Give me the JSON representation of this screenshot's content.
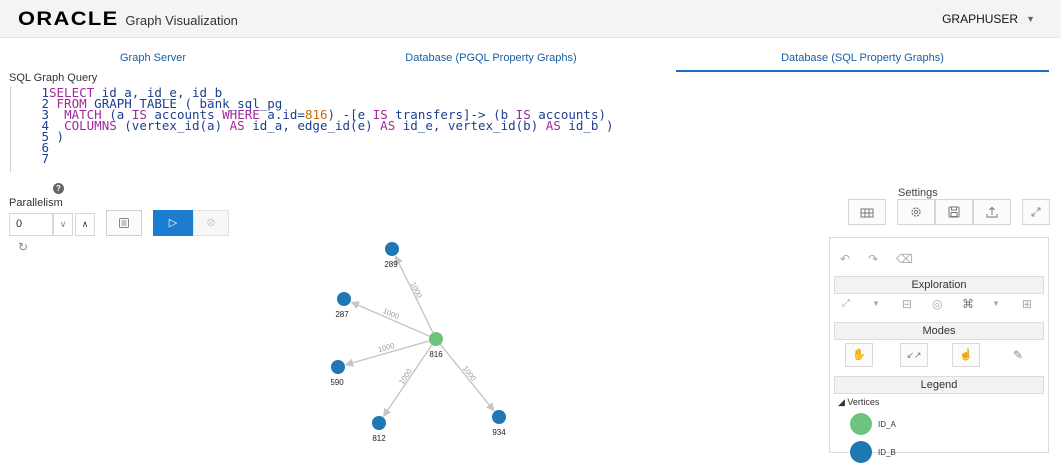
{
  "header": {
    "logo": "ORACLE",
    "title": "Graph Visualization",
    "user": "GRAPHUSER",
    "user_caret": "▼"
  },
  "tabs": [
    {
      "label": "Graph Server",
      "active": false
    },
    {
      "label": "Database (PGQL Property Graphs)",
      "active": false
    },
    {
      "label": "Database (SQL Property Graphs)",
      "active": true
    }
  ],
  "query": {
    "label": "SQL Graph Query",
    "lines": [
      "1",
      "2",
      "3",
      "4",
      "5",
      "6",
      "7"
    ]
  },
  "controls": {
    "help_glyph": "?",
    "parallelism_label": "Parallelism",
    "parallelism_value": "0",
    "down_glyph": "∨",
    "up_glyph": "∧",
    "format_icon": "format-icon",
    "run_glyph": "▷",
    "cancel_glyph": "⊘",
    "refresh_glyph": "↻"
  },
  "graph": {
    "center": {
      "label": "816",
      "color": "#6cc47f"
    },
    "neighbor_color": "#1f77b4",
    "edge_color": "#c6c6c6",
    "nodes": [
      {
        "label": "289",
        "edge_label": "1000"
      },
      {
        "label": "287",
        "edge_label": "1000"
      },
      {
        "label": "590",
        "edge_label": "1000"
      },
      {
        "label": "812",
        "edge_label": "1000"
      },
      {
        "label": "934",
        "edge_label": "1000"
      }
    ]
  },
  "settings": {
    "title": "Settings",
    "buttons": [
      "table-icon",
      "gear-icon",
      "save-icon",
      "export-icon",
      "expand-icon"
    ]
  },
  "panel": {
    "undo_glyph": "↶",
    "redo_glyph": "↷",
    "erase_glyph": "⌫",
    "exploration_label": "Exploration",
    "modes_label": "Modes",
    "legend_label": "Legend",
    "legend_sub": "Vertices",
    "legend_items": [
      {
        "label": "ID_A",
        "color": "#6cc47f"
      },
      {
        "label": "ID_B",
        "color": "#1f77b4"
      }
    ]
  }
}
